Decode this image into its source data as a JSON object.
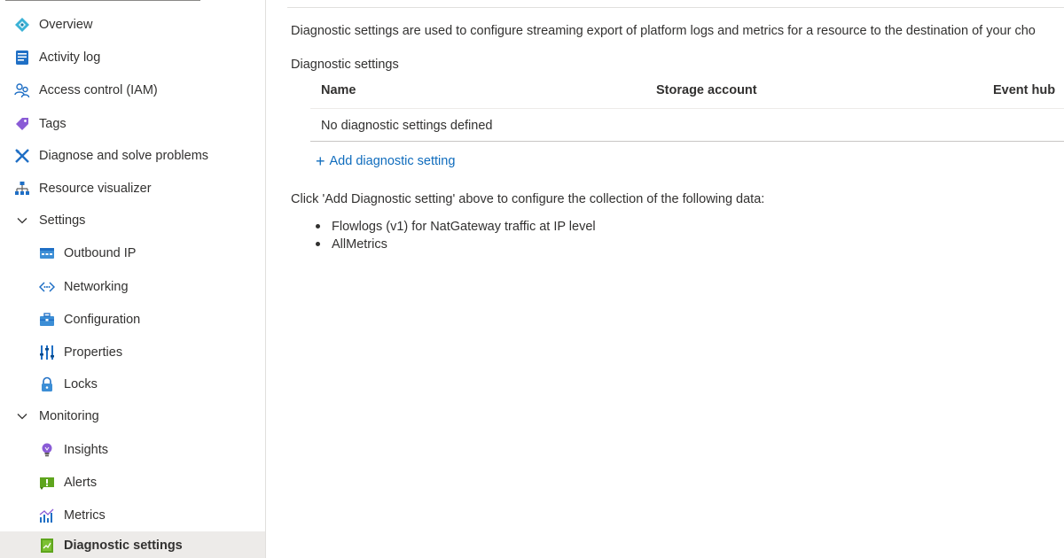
{
  "sidebar": {
    "items": [
      {
        "label": "Overview",
        "icon": "overview-icon"
      },
      {
        "label": "Activity log",
        "icon": "activity-log-icon"
      },
      {
        "label": "Access control (IAM)",
        "icon": "people-icon"
      },
      {
        "label": "Tags",
        "icon": "tag-icon"
      },
      {
        "label": "Diagnose and solve problems",
        "icon": "wrench-icon"
      },
      {
        "label": "Resource visualizer",
        "icon": "visualizer-icon"
      },
      {
        "label": "Settings",
        "icon": "chevron-down-icon"
      },
      {
        "label": "Outbound IP",
        "icon": "outbound-ip-icon"
      },
      {
        "label": "Networking",
        "icon": "networking-icon"
      },
      {
        "label": "Configuration",
        "icon": "configuration-icon"
      },
      {
        "label": "Properties",
        "icon": "properties-icon"
      },
      {
        "label": "Locks",
        "icon": "lock-icon"
      },
      {
        "label": "Monitoring",
        "icon": "chevron-down-icon"
      },
      {
        "label": "Insights",
        "icon": "insights-icon"
      },
      {
        "label": "Alerts",
        "icon": "alerts-icon"
      },
      {
        "label": "Metrics",
        "icon": "metrics-icon"
      },
      {
        "label": "Diagnostic settings",
        "icon": "diagnostic-settings-icon"
      }
    ]
  },
  "main": {
    "description": "Diagnostic settings are used to configure streaming export of platform logs and metrics for a resource to the destination of your cho",
    "section_label": "Diagnostic settings",
    "table": {
      "columns": [
        "Name",
        "Storage account",
        "Event hub"
      ],
      "empty_message": "No diagnostic settings defined"
    },
    "add_link": "Add diagnostic setting",
    "info_text": "Click 'Add Diagnostic setting' above to configure the collection of the following data:",
    "bullets": [
      "Flowlogs (v1) for NatGateway traffic at IP level",
      "AllMetrics"
    ]
  },
  "colors": {
    "link": "#0f6cbd",
    "selected_bg": "#edebe9",
    "text": "#323130"
  }
}
